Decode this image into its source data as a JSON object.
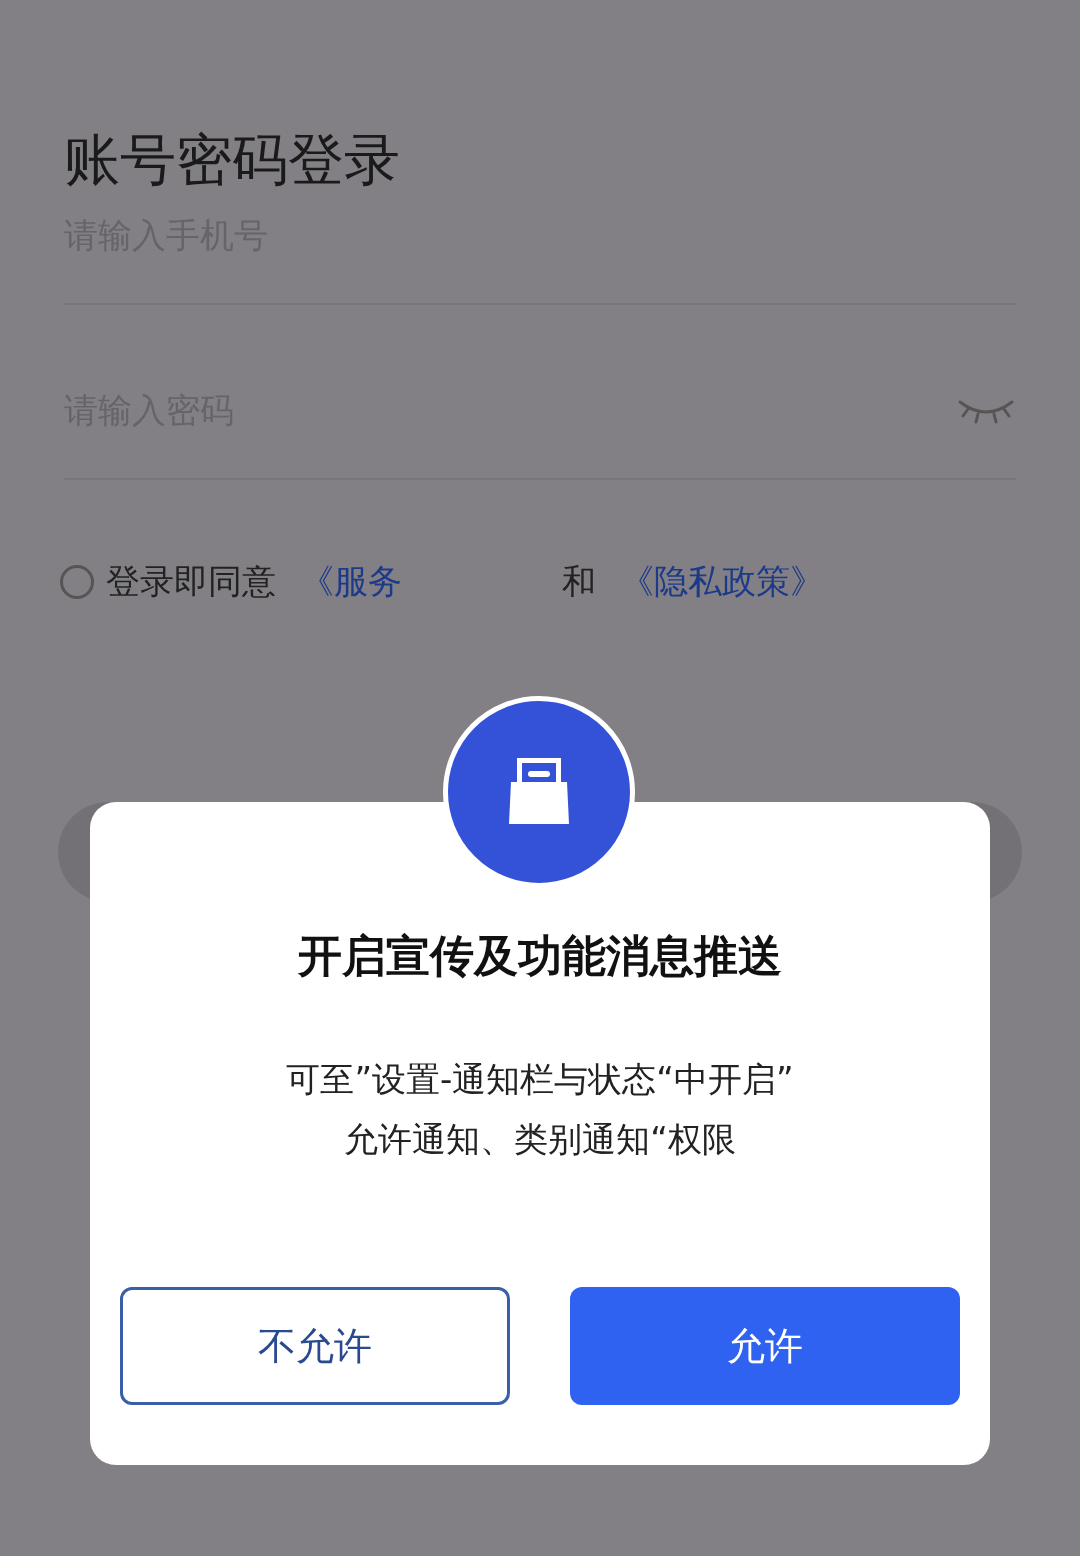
{
  "login": {
    "title": "账号密码登录",
    "fields": [
      {
        "placeholder": "请输入手机号",
        "kind": "phone"
      },
      {
        "placeholder": "请输入密码",
        "kind": "password"
      }
    ],
    "agreement": {
      "checked": false,
      "prefix": "登录即同意",
      "parts": [
        {
          "text": "《服务",
          "kind": "link"
        },
        {
          "text": "和",
          "kind": "plain"
        },
        {
          "text": "《隐私政策》",
          "kind": "link"
        }
      ]
    }
  },
  "dialog": {
    "title": "开启宣传及功能消息推送",
    "message_lines": [
      "可至”设置-通知栏与状态“中开启”",
      "允许通知、类别通知“权限"
    ],
    "buttons": [
      {
        "label": "不允许",
        "kind": "secondary"
      },
      {
        "label": "允许",
        "kind": "primary"
      }
    ]
  }
}
